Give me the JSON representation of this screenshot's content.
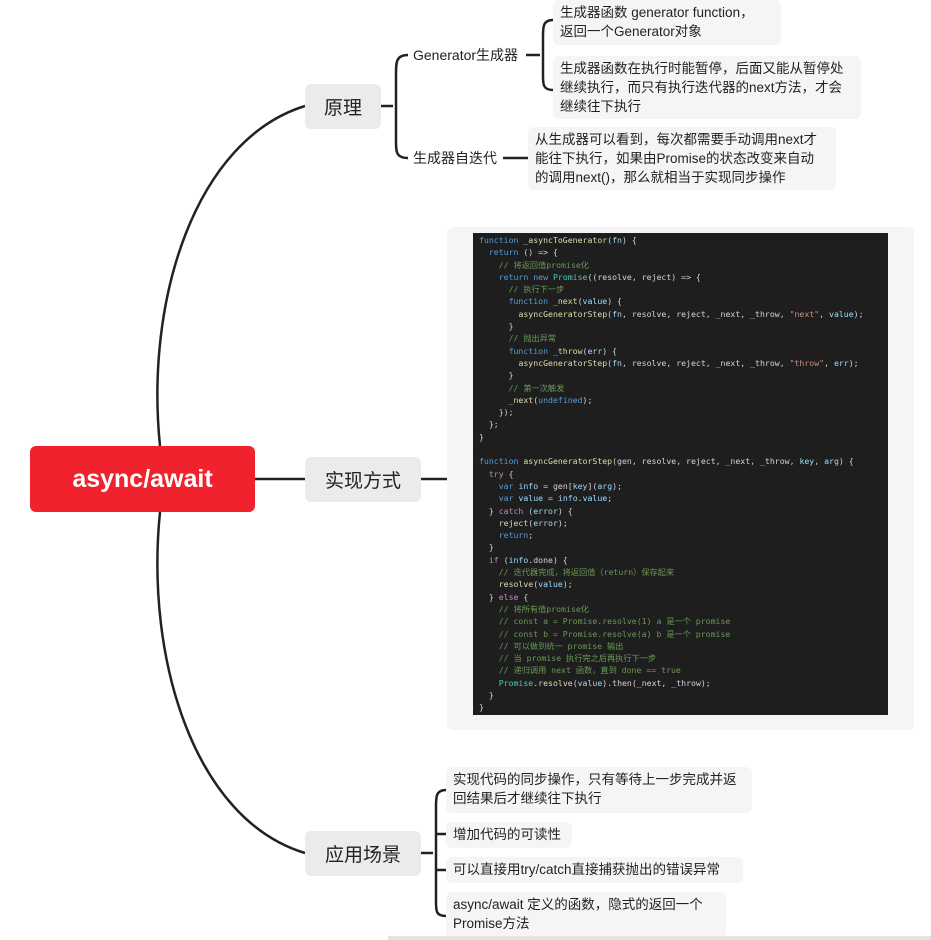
{
  "root": {
    "label": "async/await"
  },
  "colors": {
    "root": "#f0222e",
    "line": "#222222",
    "branch_bg": "#ebebeb",
    "leaf_bg": "#f5f5f5",
    "code_bg": "#1e1e1e"
  },
  "branches": {
    "principle": {
      "label": "原理",
      "children": {
        "generator": {
          "label": "Generator生成器",
          "notes": [
            [
              "生成器函数 generator function，",
              "返回一个Generator对象"
            ],
            [
              "生成器函数在执行时能暂停，后面又能从暂停处",
              "继续执行，而只有执行迭代器的next方法，才会",
              "继续往下执行"
            ]
          ]
        },
        "auto_iter": {
          "label": "生成器自迭代",
          "notes": [
            [
              "从生成器可以看到，每次都需要手动调用next才",
              "能往下执行，如果由Promise的状态改变来自动",
              "的调用next()，那么就相当于实现同步操作"
            ]
          ]
        }
      }
    },
    "implementation": {
      "label": "实现方式",
      "code_lines": [
        "function _asyncToGenerator(fn) {",
        "  return () => {",
        "    // 将返回值promise化",
        "    return new Promise((resolve, reject) => {",
        "      // 执行下一步",
        "      function _next(value) {",
        "        asyncGeneratorStep(fn, resolve, reject, _next, _throw, \"next\", value);",
        "      }",
        "      // 抛出异常",
        "      function _throw(err) {",
        "        asyncGeneratorStep(fn, resolve, reject, _next, _throw, \"throw\", err);",
        "      }",
        "      // 第一次触发",
        "      _next(undefined);",
        "    });",
        "  };",
        "}",
        "",
        "function asyncGeneratorStep(gen, resolve, reject, _next, _throw, key, arg) {",
        "  try {",
        "    var info = gen[key](arg);",
        "    var value = info.value;",
        "  } catch (error) {",
        "    reject(error);",
        "    return;",
        "  }",
        "  if (info.done) {",
        "    // 迭代器完成，将返回值（return）保存起来",
        "    resolve(value);",
        "  } else {",
        "    // 将所有值promise化",
        "    // const a = Promise.resolve(1) a 是一个 promise",
        "    // const b = Promise.resolve(a) b 是一个 promise",
        "    // 可以做到统一 promise 输出",
        "    // 当 promise 执行完之后再执行下一步",
        "    // 递归调用 next 函数，直到 done == true",
        "    Promise.resolve(value).then(_next, _throw);",
        "  }",
        "}"
      ]
    },
    "scenarios": {
      "label": "应用场景",
      "items": [
        [
          "实现代码的同步操作，只有等待上一步完成并返",
          "回结果后才继续往下执行"
        ],
        [
          "增加代码的可读性"
        ],
        [
          "可以直接用try/catch直接捕获抛出的错误异常"
        ],
        [
          "async/await 定义的函数，隐式的返回一个",
          "Promise方法"
        ]
      ]
    }
  }
}
